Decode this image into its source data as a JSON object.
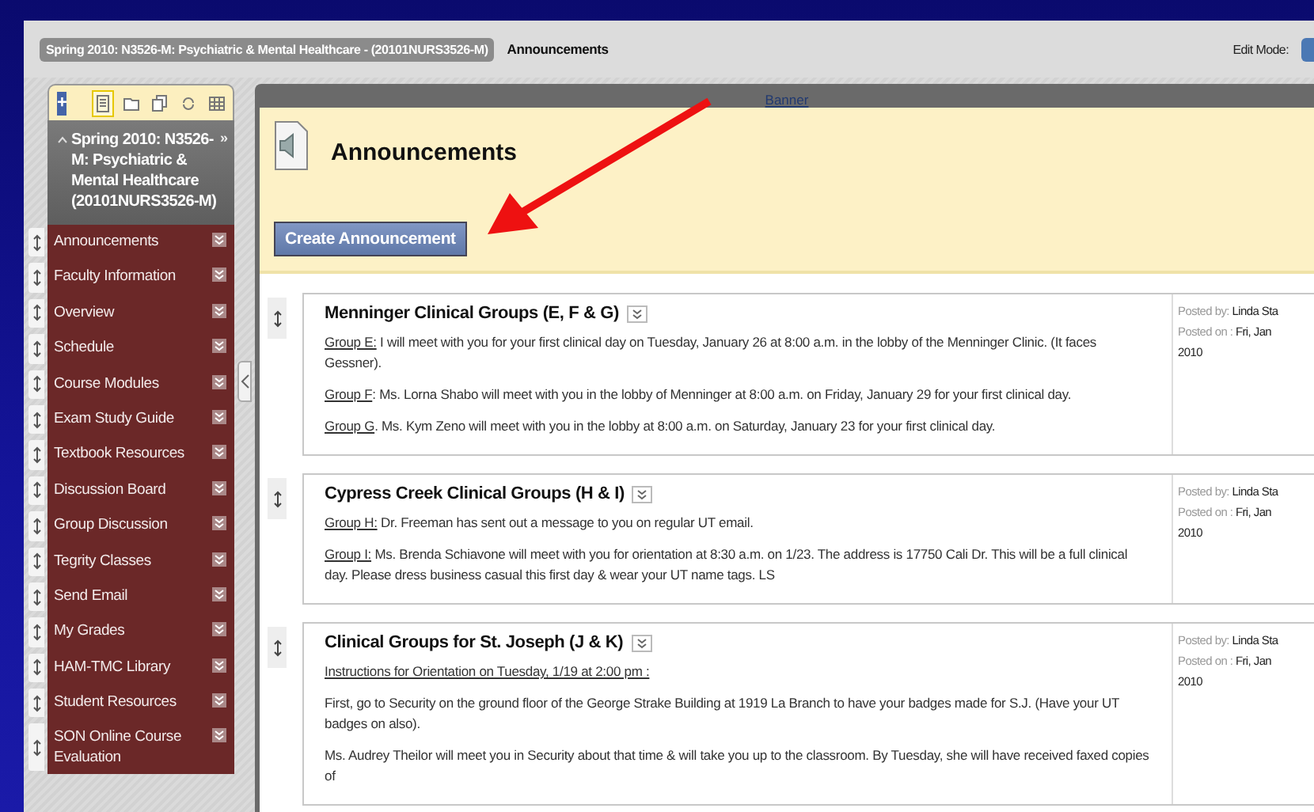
{
  "breadcrumb": {
    "course": "Spring 2010: N3526-M: Psychiatric & Mental Healthcare - (20101NURS3526-M)",
    "page": "Announcements"
  },
  "edit_mode": {
    "label": "Edit Mode:"
  },
  "sidebar": {
    "toolbar": [
      {
        "kind": "add",
        "label": "+",
        "selected": false
      },
      {
        "kind": "list",
        "selected": true
      },
      {
        "kind": "folder",
        "selected": false
      },
      {
        "kind": "pages",
        "selected": false
      },
      {
        "kind": "refresh",
        "selected": false
      },
      {
        "kind": "grid",
        "selected": false
      }
    ],
    "course_title": "Spring 2010: N3526-M: Psychiatric & Mental Healthcare (20101NURS3526-M)",
    "more": "»",
    "items": [
      {
        "label": "Announcements"
      },
      {
        "label": "Faculty Information"
      },
      {
        "label": "Overview"
      },
      {
        "label": "Schedule"
      },
      {
        "label": "Course Modules"
      },
      {
        "label": "Exam Study Guide"
      },
      {
        "label": "Textbook Resources"
      },
      {
        "label": "Discussion Board"
      },
      {
        "label": "Group Discussion"
      },
      {
        "label": "Tegrity Classes"
      },
      {
        "label": "Send Email"
      },
      {
        "label": "My Grades"
      },
      {
        "label": "HAM-TMC Library"
      },
      {
        "label": "Student Resources"
      },
      {
        "label": "SON Online Course Evaluation"
      }
    ]
  },
  "banner_link": "Banner",
  "page_title": "Announcements",
  "create_button": "Create Announcement",
  "announcements": [
    {
      "title": "Menninger Clinical Groups (E, F & G)",
      "posted_by_label": "Posted by:",
      "posted_by": "Linda Sta",
      "posted_on_label": "Posted on :",
      "date_line_1": "Fri, Jan",
      "date_line_2": "2010",
      "paragraphs": [
        {
          "label": "Group E:",
          "text": "I will meet with you for your first clinical day on Tuesday, January 26 at 8:00 a.m. in the lobby of the Menninger Clinic. (It faces Gessner)."
        },
        {
          "label": "Group F",
          "text": ":  Ms. Lorna Shabo will meet with you in the lobby of Menninger at 8:00 a.m. on Friday, January 29 for your first clinical day."
        },
        {
          "label": "Group G",
          "text": ". Ms. Kym Zeno will meet with you in the lobby at 8:00 a.m. on Saturday, January 23 for your first clinical day."
        }
      ]
    },
    {
      "title": "Cypress Creek Clinical Groups (H & I)",
      "posted_by_label": "Posted by:",
      "posted_by": "Linda Sta",
      "posted_on_label": "Posted on :",
      "date_line_1": "Fri, Jan",
      "date_line_2": "2010",
      "paragraphs": [
        {
          "label": "Group H:",
          "text": "Dr. Freeman has sent out a message to you on regular UT email."
        },
        {
          "label": "Group I:",
          "text": "Ms. Brenda Schiavone will meet with you for orientation at 8:30 a.m. on 1/23. The address is 17750 Cali Dr. This will be a full clinical day. Please dress business casual this first day & wear your UT name tags. LS"
        }
      ]
    },
    {
      "title": "Clinical Groups for St. Joseph (J & K)",
      "posted_by_label": "Posted by:",
      "posted_by": "Linda Sta",
      "posted_on_label": "Posted on :",
      "date_line_1": "Fri, Jan",
      "date_line_2": "2010",
      "paragraphs": [
        {
          "label": "Instructions for Orientation on Tuesday, 1/19 at 2:00 pm :"
        },
        {
          "text": "First, go to Security on the ground floor of the George Strake Building at 1919 La Branch to have your badges made for S.J. (Have your UT badges on also)."
        },
        {
          "text": "Ms. Audrey Theilor will meet you in Security about that time & will take you up to the classroom. By Tuesday, she will have received faxed copies of"
        }
      ]
    }
  ]
}
